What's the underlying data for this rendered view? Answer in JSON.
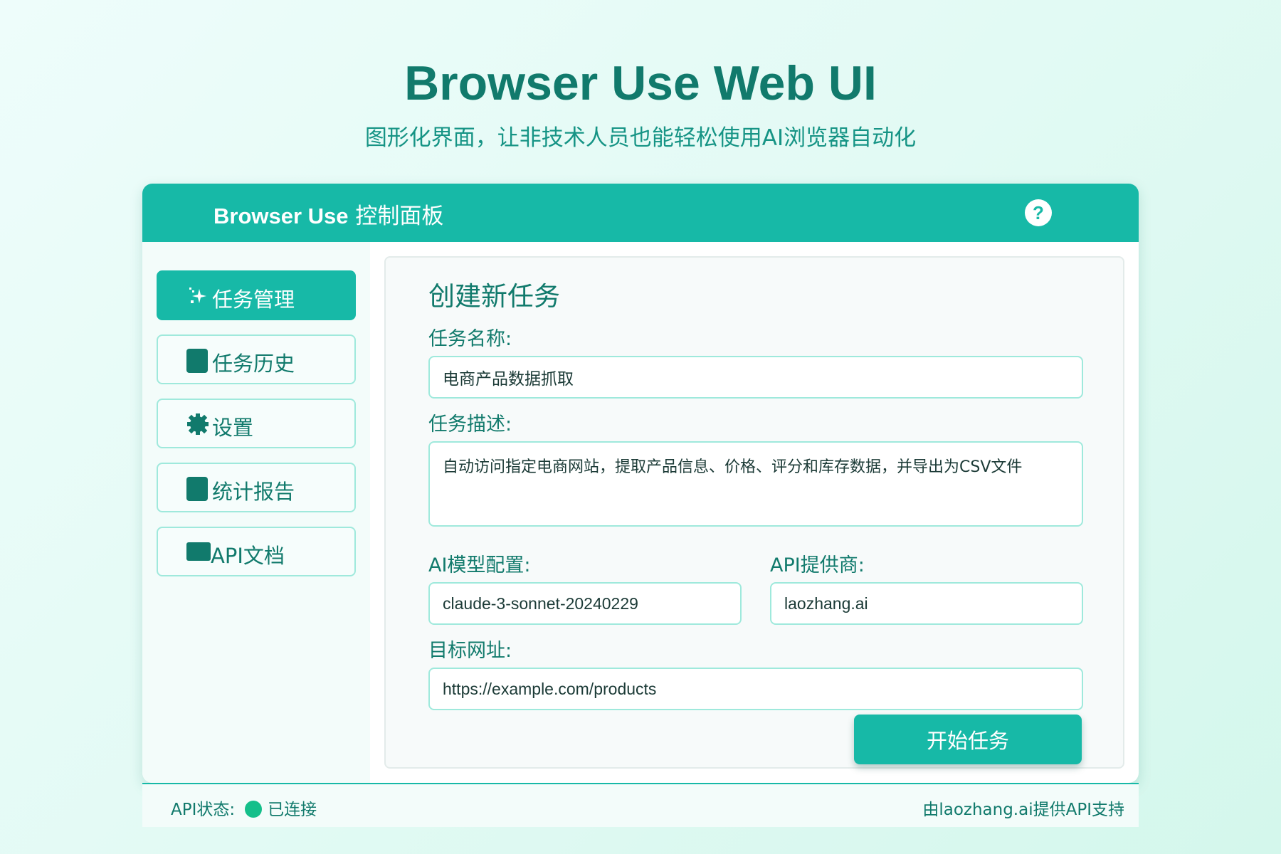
{
  "hero": {
    "title": "Browser Use Web UI",
    "subtitle": "图形化界面，让非技术人员也能轻松使用AI浏览器自动化"
  },
  "panel": {
    "title_en": "Browser Use",
    "title_zh": "控制面板",
    "help_label": "?"
  },
  "sidebar": {
    "items": [
      {
        "label": "任务管理",
        "icon": "sparkles-icon",
        "active": true
      },
      {
        "label": "任务历史",
        "icon": "history-icon",
        "active": false
      },
      {
        "label": "设置",
        "icon": "gear-icon",
        "active": false
      },
      {
        "label": "统计报告",
        "icon": "chart-icon",
        "active": false
      },
      {
        "label": "API文档",
        "icon": "document-icon",
        "active": false
      }
    ]
  },
  "form": {
    "heading": "创建新任务",
    "task_name": {
      "label": "任务名称:",
      "value": "电商产品数据抓取"
    },
    "task_desc": {
      "label": "任务描述:",
      "value": "自动访问指定电商网站，提取产品信息、价格、评分和库存数据，并导出为CSV文件"
    },
    "model": {
      "label": "AI模型配置:",
      "value": "claude-3-sonnet-20240229"
    },
    "provider": {
      "label": "API提供商:",
      "value": "laozhang.ai"
    },
    "url": {
      "label": "目标网址:",
      "value": "https://example.com/products"
    },
    "submit_label": "开始任务"
  },
  "footer": {
    "status_label": "API状态:",
    "status_value": "已连接",
    "credit": "由laozhang.ai提供API支持"
  },
  "colors": {
    "accent": "#17b9a7",
    "text_dark": "#117a6c",
    "status_connected": "#14bf8a"
  }
}
